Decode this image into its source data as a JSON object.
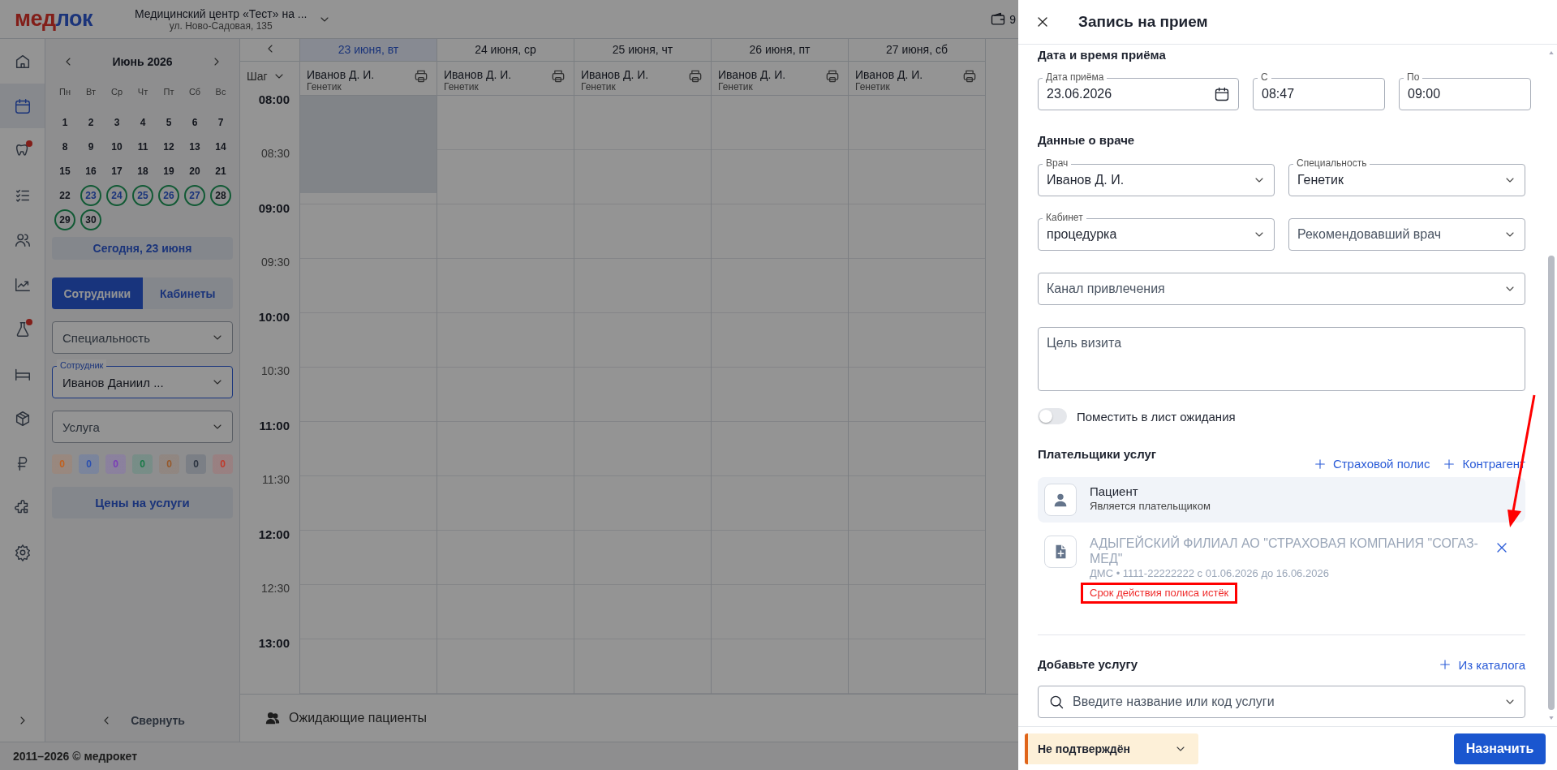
{
  "header": {
    "logo_parts": [
      "мед",
      "лок"
    ],
    "clinic": "Медицинский центр «Тест» на ...",
    "address": "ул. Ново-Садовая, 135",
    "wallet_count": "9"
  },
  "nav_rail": [
    {
      "selected": false,
      "badge": false
    },
    {
      "selected": true,
      "badge": false
    },
    {
      "selected": false,
      "badge": true
    },
    {
      "selected": false,
      "badge": false
    },
    {
      "selected": false,
      "badge": false
    },
    {
      "selected": false,
      "badge": false
    },
    {
      "selected": false,
      "badge": true
    },
    {
      "selected": false,
      "badge": false
    },
    {
      "selected": false,
      "badge": false
    },
    {
      "selected": false,
      "badge": false
    },
    {
      "selected": false,
      "badge": false
    },
    {
      "selected": false,
      "badge": false
    }
  ],
  "mini_calendar": {
    "title": "Июнь 2026",
    "weekdays": [
      "Пн",
      "Вт",
      "Ср",
      "Чт",
      "Пт",
      "Сб",
      "Вс"
    ],
    "weeks": [
      [
        {
          "label": "1",
          "ringed": false,
          "accent": false
        },
        {
          "label": "2",
          "ringed": false,
          "accent": false
        },
        {
          "label": "3",
          "ringed": false,
          "accent": false
        },
        {
          "label": "4",
          "ringed": false,
          "accent": false
        },
        {
          "label": "5",
          "ringed": false,
          "accent": false
        },
        {
          "label": "6",
          "ringed": false,
          "accent": false
        },
        {
          "label": "7",
          "ringed": false,
          "accent": false
        }
      ],
      [
        {
          "label": "8",
          "ringed": false,
          "accent": false
        },
        {
          "label": "9",
          "ringed": false,
          "accent": false
        },
        {
          "label": "10",
          "ringed": false,
          "accent": false
        },
        {
          "label": "11",
          "ringed": false,
          "accent": false
        },
        {
          "label": "12",
          "ringed": false,
          "accent": false
        },
        {
          "label": "13",
          "ringed": false,
          "accent": false
        },
        {
          "label": "14",
          "ringed": false,
          "accent": false
        }
      ],
      [
        {
          "label": "15",
          "ringed": false,
          "accent": false
        },
        {
          "label": "16",
          "ringed": false,
          "accent": false
        },
        {
          "label": "17",
          "ringed": false,
          "accent": false
        },
        {
          "label": "18",
          "ringed": false,
          "accent": false
        },
        {
          "label": "19",
          "ringed": false,
          "accent": false
        },
        {
          "label": "20",
          "ringed": false,
          "accent": false
        },
        {
          "label": "21",
          "ringed": false,
          "accent": false
        }
      ],
      [
        {
          "label": "22",
          "ringed": false,
          "accent": false
        },
        {
          "label": "23",
          "ringed": true,
          "accent": true
        },
        {
          "label": "24",
          "ringed": true,
          "accent": true
        },
        {
          "label": "25",
          "ringed": true,
          "accent": true
        },
        {
          "label": "26",
          "ringed": true,
          "accent": true
        },
        {
          "label": "27",
          "ringed": true,
          "accent": true
        },
        {
          "label": "28",
          "ringed": true,
          "accent": false
        }
      ],
      [
        {
          "label": "29",
          "ringed": true,
          "accent": false
        },
        {
          "label": "30",
          "ringed": true,
          "accent": false
        }
      ]
    ]
  },
  "today_button": "Сегодня, 23 июня",
  "view_tabs": [
    {
      "label": "Сотрудники",
      "selected": true
    },
    {
      "label": "Кабинеты",
      "selected": false
    }
  ],
  "filters": [
    {
      "placeholder": "Специальность",
      "focused": false
    },
    {
      "label": "Сотрудник",
      "value": "Иванов Даниил ...",
      "focused": true
    },
    {
      "placeholder": "Услуга",
      "focused": false
    }
  ],
  "status_counters": [
    {
      "count": "0",
      "color": "#c0601e"
    },
    {
      "count": "0",
      "color": "#2a4fb0"
    },
    {
      "count": "0",
      "color": "#7a3cb8"
    },
    {
      "count": "0",
      "color": "#1a7a48"
    },
    {
      "count": "0",
      "color": "#96582a"
    },
    {
      "count": "0",
      "color": "#2b3340"
    },
    {
      "count": "0",
      "color": "#c0392b"
    }
  ],
  "prices_button": "Цены на услуги",
  "collapse_button": "Свернуть",
  "schedule": {
    "step_label": "Шаг",
    "days": [
      {
        "date": "23 июня, вт",
        "selected": true,
        "doctor": "Иванов Д. И.",
        "specialty": "Генетик"
      },
      {
        "date": "24 июня, ср",
        "selected": false,
        "doctor": "Иванов Д. И.",
        "specialty": "Генетик"
      },
      {
        "date": "25 июня, чт",
        "selected": false,
        "doctor": "Иванов Д. И.",
        "specialty": "Генетик"
      },
      {
        "date": "26 июня, пт",
        "selected": false,
        "doctor": "Иванов Д. И.",
        "specialty": "Генетик"
      },
      {
        "date": "27 июня, сб",
        "selected": false,
        "doctor": "Иванов Д. И.",
        "specialty": "Генетик"
      }
    ],
    "times": [
      {
        "label": "08:00",
        "hour": true
      },
      {
        "label": "08:30",
        "hour": false
      },
      {
        "label": "09:00",
        "hour": true
      },
      {
        "label": "09:30",
        "hour": false
      },
      {
        "label": "10:00",
        "hour": true
      },
      {
        "label": "10:30",
        "hour": false
      },
      {
        "label": "11:00",
        "hour": true
      },
      {
        "label": "11:30",
        "hour": false
      },
      {
        "label": "12:00",
        "hour": true
      },
      {
        "label": "12:30",
        "hour": false
      },
      {
        "label": "13:00",
        "hour": true
      }
    ],
    "waiting_label": "Ожидающие пациенты"
  },
  "footer": "2011–2026 © медрокет",
  "appointment_panel": {
    "title": "Запись на прием",
    "date_section": {
      "heading": "Дата и время приёма",
      "date": {
        "label": "Дата приёма",
        "value": "23.06.2026"
      },
      "from": {
        "label": "С",
        "value": "08:47"
      },
      "to": {
        "label": "По",
        "value": "09:00"
      }
    },
    "doctor_section": {
      "heading": "Данные о враче",
      "fields": [
        {
          "label": "Врач",
          "value": "Иванов Д. И."
        },
        {
          "label": "Специальность",
          "value": "Генетик"
        },
        {
          "label": "Кабинет",
          "value": "процедурка"
        },
        {
          "placeholder": "Рекомендовавший врач"
        }
      ],
      "channel": {
        "placeholder": "Канал привлечения"
      },
      "purpose": {
        "placeholder": "Цель визита"
      }
    },
    "waiting_list": {
      "label": "Поместить в лист ожидания",
      "on": false
    },
    "payers": {
      "heading": "Плательщики услуг",
      "actions": [
        "Страховой полис",
        "Контрагент"
      ],
      "items": [
        {
          "kind": "patient",
          "name": "Пациент",
          "note": "Является плательщиком",
          "disabled": false
        },
        {
          "kind": "policy",
          "name": "АДЫГЕЙСКИЙ ФИЛИАЛ АО \"СТРАХОВАЯ КОМПАНИЯ \"СОГАЗ-МЕД\"",
          "note": "ДМС • 1111-22222222 с 01.06.2026 до 16.06.2026",
          "warning": "Срок действия полиса истёк",
          "disabled": true
        }
      ]
    },
    "services": {
      "heading": "Добавьте услугу",
      "action": "Из каталога",
      "search": {
        "placeholder": "Введите название или код услуги"
      }
    },
    "status": "Не подтверждён",
    "submit": "Назначить"
  }
}
